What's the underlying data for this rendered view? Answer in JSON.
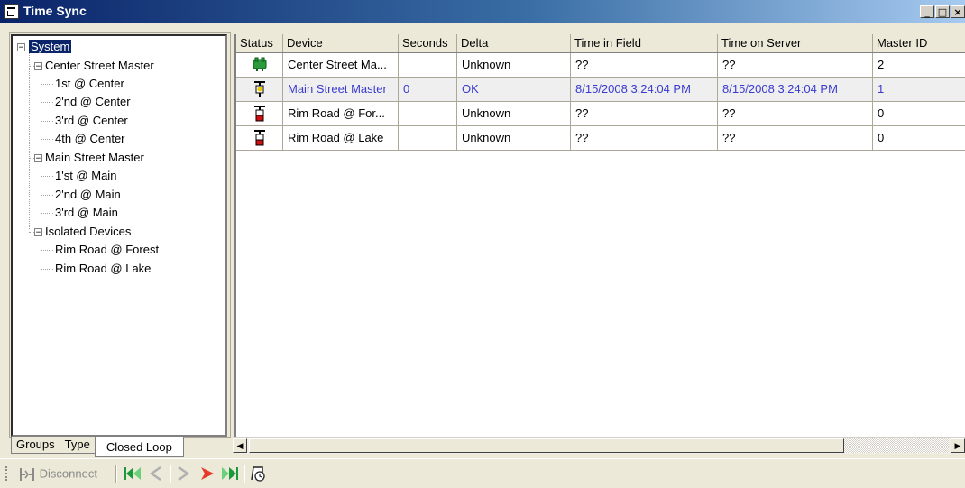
{
  "window": {
    "title": "Time Sync",
    "buttons": [
      "_",
      "□",
      "×"
    ]
  },
  "tree": {
    "root": "System",
    "groups": [
      {
        "label": "Center Street Master",
        "children": [
          "1st @ Center",
          "2'nd @ Center",
          "3'rd @ Center",
          "4th @ Center"
        ]
      },
      {
        "label": "Main Street Master",
        "children": [
          "1'st @ Main",
          "2'nd @ Main",
          "3'rd @ Main"
        ]
      },
      {
        "label": "Isolated Devices",
        "children": [
          "Rim Road @ Forest",
          "Rim Road @ Lake"
        ]
      }
    ]
  },
  "tabs": [
    "Groups",
    "Type",
    "Closed Loop"
  ],
  "active_tab": "Closed Loop",
  "table": {
    "columns": [
      "Status",
      "Device",
      "Seconds",
      "Delta",
      "Time in Field",
      "Time on Server",
      "Master ID"
    ],
    "rows": [
      {
        "status_icon": "green-signal-icon",
        "device": "Center Street Ma...",
        "seconds": "",
        "delta": "Unknown",
        "time_field": "??",
        "time_server": "??",
        "master_id": "2"
      },
      {
        "status_icon": "yellow-signal-icon",
        "device": "Main Street Master",
        "seconds": "0",
        "delta": "OK",
        "time_field": "8/15/2008 3:24:04 PM",
        "time_server": "8/15/2008 3:24:04 PM",
        "master_id": "1"
      },
      {
        "status_icon": "red-signal-icon",
        "device": "Rim Road @ For...",
        "seconds": "",
        "delta": "Unknown",
        "time_field": "??",
        "time_server": "??",
        "master_id": "0"
      },
      {
        "status_icon": "red-signal-icon",
        "device": "Rim Road @ Lake",
        "seconds": "",
        "delta": "Unknown",
        "time_field": "??",
        "time_server": "??",
        "master_id": "0"
      }
    ]
  },
  "toolbar": {
    "disconnect_label": "Disconnect",
    "icons": [
      "disconnect-icon",
      "first-icon",
      "previous-icon",
      "next-icon",
      "last-icon",
      "time-sync-icon"
    ]
  },
  "colors": {
    "title_dark": "#0a246a",
    "selection": "#0a246a",
    "selected_row_text": "#3a3ad0",
    "chrome": "#ece9d8"
  }
}
